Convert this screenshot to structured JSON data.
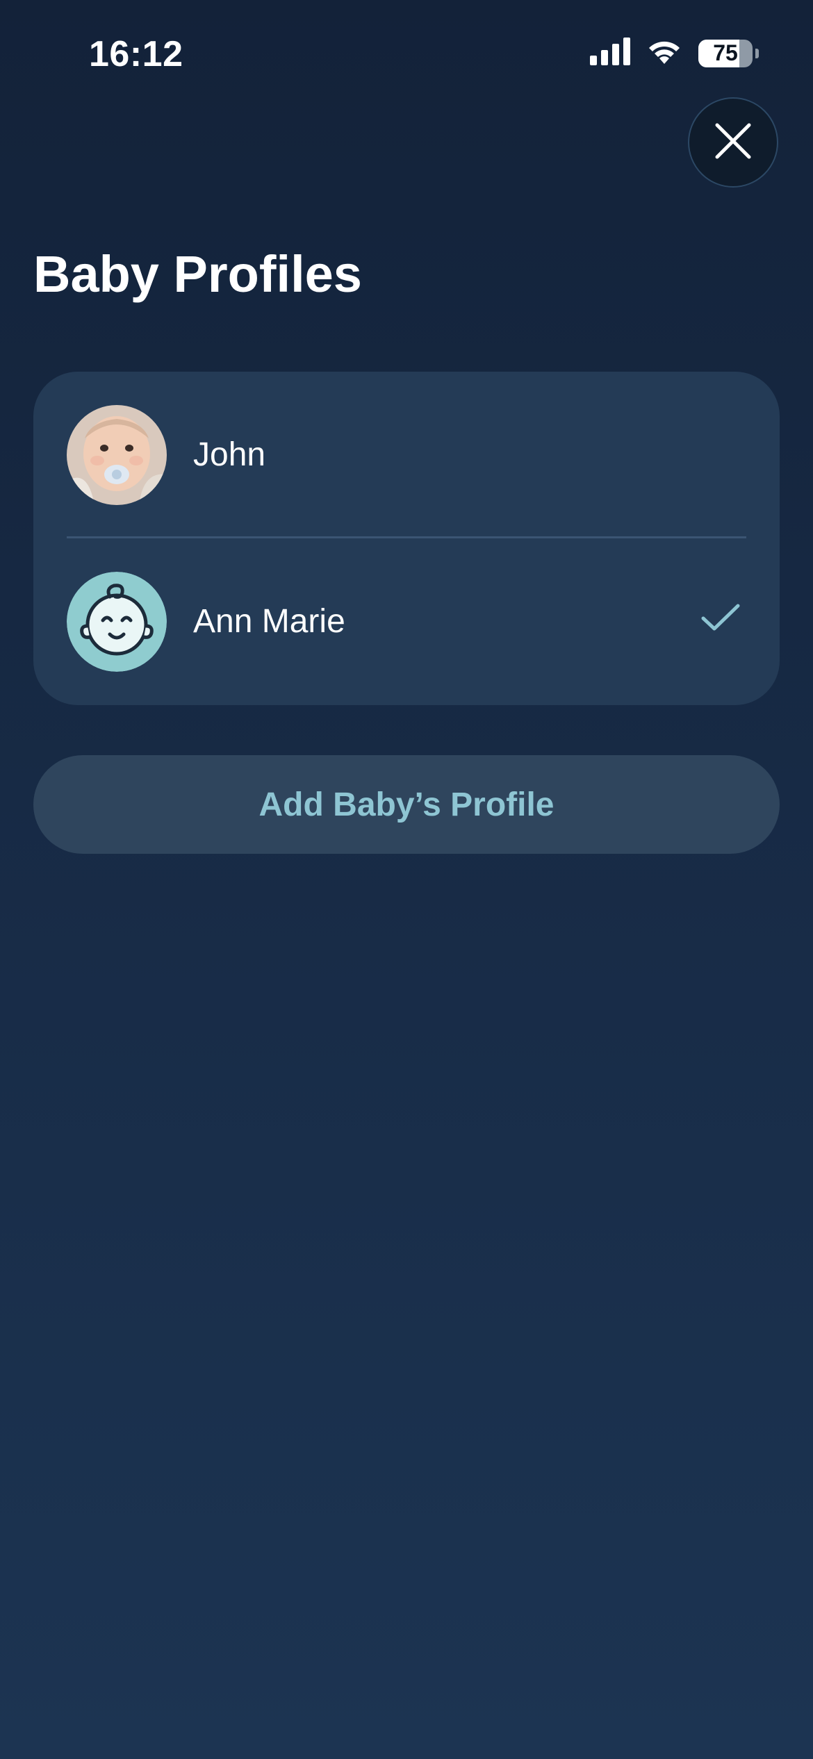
{
  "status_bar": {
    "time": "16:12",
    "battery_percent": 75,
    "battery_text": "75",
    "icons": [
      "cellular-signal-icon",
      "wifi-icon",
      "battery-icon"
    ]
  },
  "header": {
    "close_icon": "close-icon",
    "title": "Baby Profiles"
  },
  "profiles": [
    {
      "name": "John",
      "avatar": "baby-photo-avatar",
      "selected": false
    },
    {
      "name": "Ann Marie",
      "avatar": "baby-face-icon",
      "selected": true,
      "selected_icon": "checkmark-icon"
    }
  ],
  "add_profile": {
    "label": "Add Baby’s Profile"
  },
  "colors": {
    "background_top": "#132239",
    "background_bottom": "#1c3452",
    "card": "#243b56",
    "button": "#2f455d",
    "accent": "#8ec5d3",
    "avatar_teal": "#8fcccf"
  }
}
